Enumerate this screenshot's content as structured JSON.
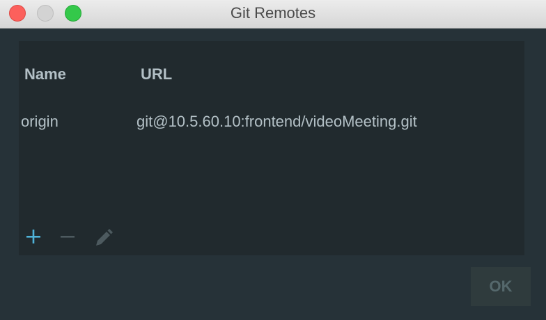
{
  "window": {
    "title": "Git Remotes"
  },
  "table": {
    "columns": [
      "Name",
      "URL"
    ],
    "rows": [
      {
        "name": "origin",
        "url": "git@10.5.60.10:frontend/videoMeeting.git"
      }
    ]
  },
  "toolbar": {
    "add_icon": "plus-icon",
    "remove_icon": "minus-icon",
    "edit_icon": "pencil-icon"
  },
  "footer": {
    "ok_label": "OK"
  },
  "colors": {
    "background": "#263238",
    "panel": "#212a2e",
    "text": "#b3c0c6",
    "accent": "#4fb3d9",
    "disabled": "#4d5a5f",
    "close": "#fc605c",
    "zoom": "#34c84a"
  }
}
